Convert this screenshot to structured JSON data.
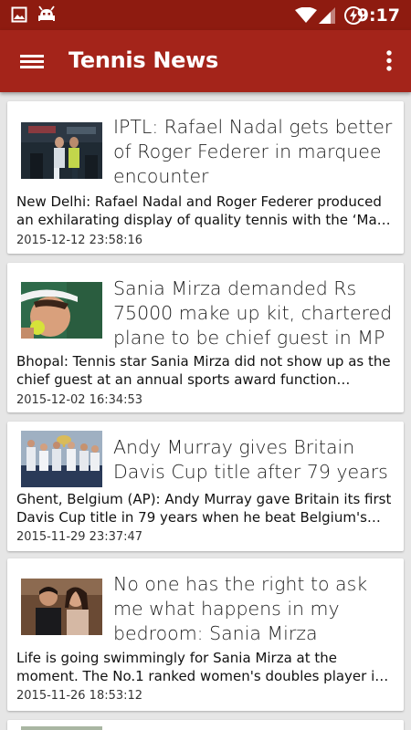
{
  "status_bar": {
    "time": "9:17",
    "left_icons": [
      "image-icon",
      "android-debug-icon"
    ],
    "right_icons": [
      "wifi-icon",
      "signal-icon",
      "battery-charging-icon"
    ]
  },
  "app_bar": {
    "title": "Tennis News",
    "menu_icon": "hamburger-menu-icon",
    "overflow_icon": "more-vertical-icon",
    "color": "#a4241a",
    "status_color": "#8e1b10"
  },
  "articles": [
    {
      "headline": "IPTL: Rafael Nadal gets better of Roger Federer in marquee encounter",
      "summary": "New Delhi: Rafael Nadal and Roger Federer produced an exhilarating display of quality tennis with the ‘Ma…",
      "date": "2015-12-12 23:58:16"
    },
    {
      "headline": "Sania Mirza demanded Rs 75000 make up kit, chartered plane to be chief guest in MP",
      "summary": "Bhopal: Tennis star Sania Mirza did not show up as the chief guest at an annual sports award function…",
      "date": "2015-12-02 16:34:53"
    },
    {
      "headline": "Andy Murray gives Britain Davis Cup title after 79 years",
      "summary": "Ghent, Belgium (AP): Andy Murray gave Britain its first Davis Cup title in 79 years when he beat Belgium's…",
      "date": "2015-11-29 23:37:47"
    },
    {
      "headline": "No one has the right to ask me what happens in my bedroom: Sania Mirza",
      "summary": "Life is going swimmingly for Sania Mirza at the moment. The No.1 ranked women's doubles player i…",
      "date": "2015-11-26 18:53:12"
    }
  ]
}
